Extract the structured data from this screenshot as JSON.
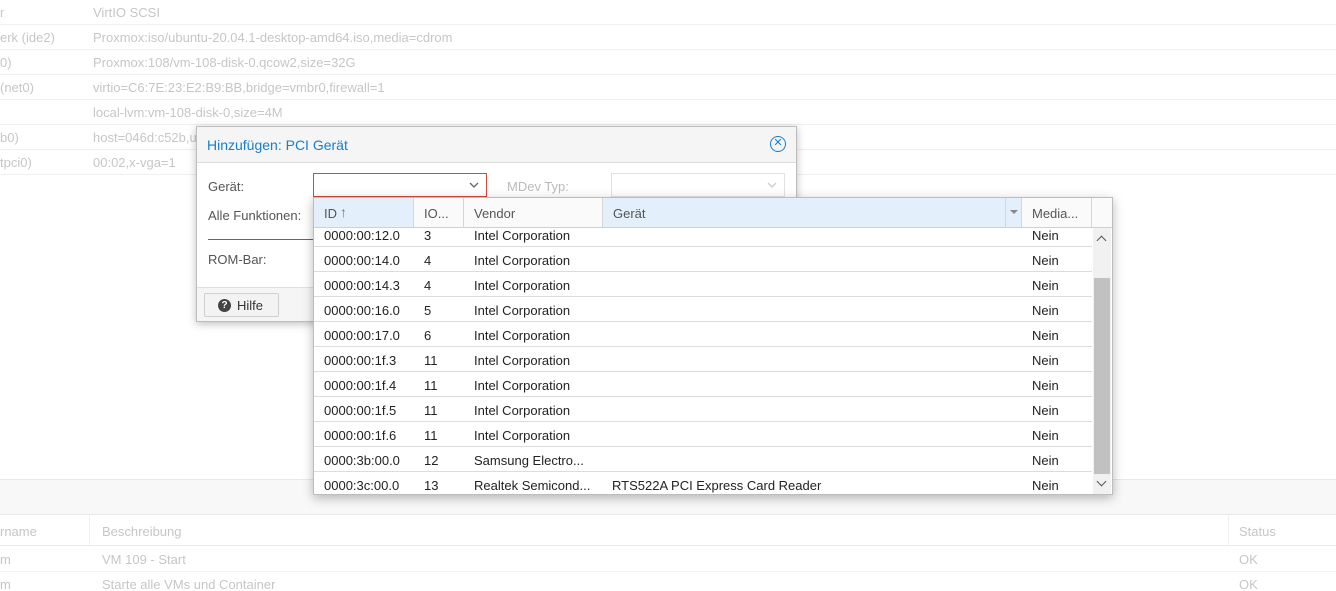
{
  "hardware": [
    {
      "key": "r",
      "value": "VirtIO SCSI"
    },
    {
      "key": "erk (ide2)",
      "value": "Proxmox:iso/ubuntu-20.04.1-desktop-amd64.iso,media=cdrom"
    },
    {
      "key": "0)",
      "value": "Proxmox:108/vm-108-disk-0.qcow2,size=32G"
    },
    {
      "key": "(net0)",
      "value": "virtio=C6:7E:23:E2:B9:BB,bridge=vmbr0,firewall=1"
    },
    {
      "key": "",
      "value": "local-lvm:vm-108-disk-0,size=4M"
    },
    {
      "key": "b0)",
      "value": "host=046d:c52b,u"
    },
    {
      "key": "tpci0)",
      "value": "00:02,x-vga=1"
    }
  ],
  "dialog": {
    "title": "Hinzufügen: PCI Gerät",
    "device_label": "Gerät:",
    "mdev_label": "MDev Typ:",
    "all_functions_label": "Alle Funktionen:",
    "rombar_label": "ROM-Bar:",
    "help_label": "Hilfe"
  },
  "picker": {
    "columns": [
      "ID",
      "IO...",
      "Vendor",
      "Gerät",
      "Media..."
    ],
    "rows": [
      {
        "id": "0000:00:12.0",
        "iommu": "3",
        "vendor": "Intel Corporation",
        "device": "",
        "mdev": "Nein"
      },
      {
        "id": "0000:00:14.0",
        "iommu": "4",
        "vendor": "Intel Corporation",
        "device": "",
        "mdev": "Nein"
      },
      {
        "id": "0000:00:14.3",
        "iommu": "4",
        "vendor": "Intel Corporation",
        "device": "",
        "mdev": "Nein"
      },
      {
        "id": "0000:00:16.0",
        "iommu": "5",
        "vendor": "Intel Corporation",
        "device": "",
        "mdev": "Nein"
      },
      {
        "id": "0000:00:17.0",
        "iommu": "6",
        "vendor": "Intel Corporation",
        "device": "",
        "mdev": "Nein"
      },
      {
        "id": "0000:00:1f.3",
        "iommu": "11",
        "vendor": "Intel Corporation",
        "device": "",
        "mdev": "Nein"
      },
      {
        "id": "0000:00:1f.4",
        "iommu": "11",
        "vendor": "Intel Corporation",
        "device": "",
        "mdev": "Nein"
      },
      {
        "id": "0000:00:1f.5",
        "iommu": "11",
        "vendor": "Intel Corporation",
        "device": "",
        "mdev": "Nein"
      },
      {
        "id": "0000:00:1f.6",
        "iommu": "11",
        "vendor": "Intel Corporation",
        "device": "",
        "mdev": "Nein"
      },
      {
        "id": "0000:3b:00.0",
        "iommu": "12",
        "vendor": "Samsung Electro...",
        "device": "",
        "mdev": "Nein"
      },
      {
        "id": "0000:3c:00.0",
        "iommu": "13",
        "vendor": "Realtek Semicond...",
        "device": "RTS522A PCI Express Card Reader",
        "mdev": "Nein"
      }
    ]
  },
  "tasks": {
    "columns": [
      "rname",
      "Beschreibung",
      "Status"
    ],
    "rows": [
      {
        "user": "m",
        "description": "VM 109 - Start",
        "status": "OK"
      },
      {
        "user": "m",
        "description": "Starte alle VMs und Container",
        "status": "OK"
      }
    ]
  },
  "colors": {
    "accent": "#157fcc",
    "invalid_border": "#cf4c35"
  },
  "icons": {
    "close": "close-circle-icon",
    "help": "question-circle-icon",
    "sort": "sort-ascending-icon"
  }
}
